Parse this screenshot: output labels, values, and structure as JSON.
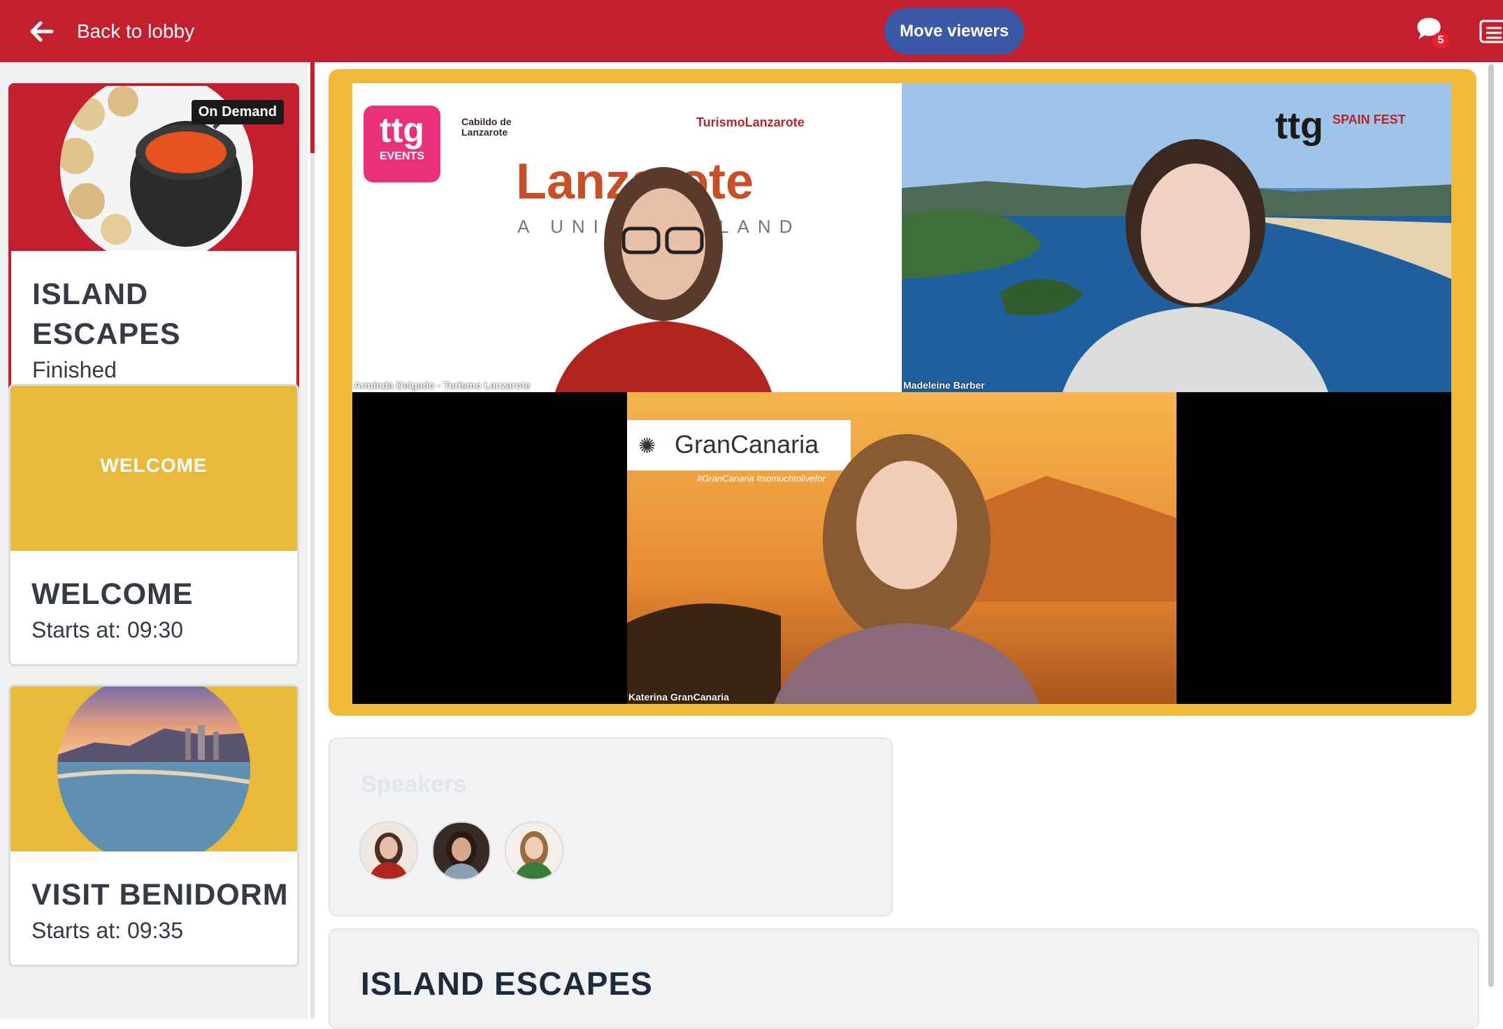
{
  "header": {
    "back_label": "Back to lobby",
    "move_viewers_label": "Move viewers",
    "chat_count": "5",
    "colors": {
      "bar": "#c41f2e",
      "button": "#3a58a6"
    },
    "icons": [
      "arrow-left-icon",
      "chat-bubble-icon",
      "agenda-icon"
    ]
  },
  "sidebar": {
    "sessions": [
      {
        "title": "ISLAND ESCAPES",
        "status": "Finished",
        "badge": "On Demand"
      },
      {
        "title": "WELCOME",
        "banner_text": "WELCOME",
        "status": "Starts at: 09:30"
      },
      {
        "title": "VISIT BENIDORM",
        "status": "Starts at: 09:35"
      }
    ]
  },
  "video": {
    "participants": [
      {
        "name": "Arminda Delgado - Turismo Lanzarote",
        "brand_top": "TurismoLanzarote",
        "brand_main": "Lanzarote",
        "brand_sub": "A UNIQUE ISLAND",
        "logo": "ttg",
        "logo_sub": "EVENTS",
        "org": "Cabildo de Lanzarote"
      },
      {
        "name": "Madeleine Barber",
        "logo": "ttg",
        "logo_sub": "SPAIN FEST"
      },
      {
        "name": "Katerina GranCanaria",
        "brand_main": "GranCanaria",
        "brand_sub": "#GranCanaria #somuchtolivefor"
      }
    ]
  },
  "speakers": {
    "title": "Speakers",
    "count": 3
  },
  "session": {
    "title": "ISLAND ESCAPES"
  }
}
